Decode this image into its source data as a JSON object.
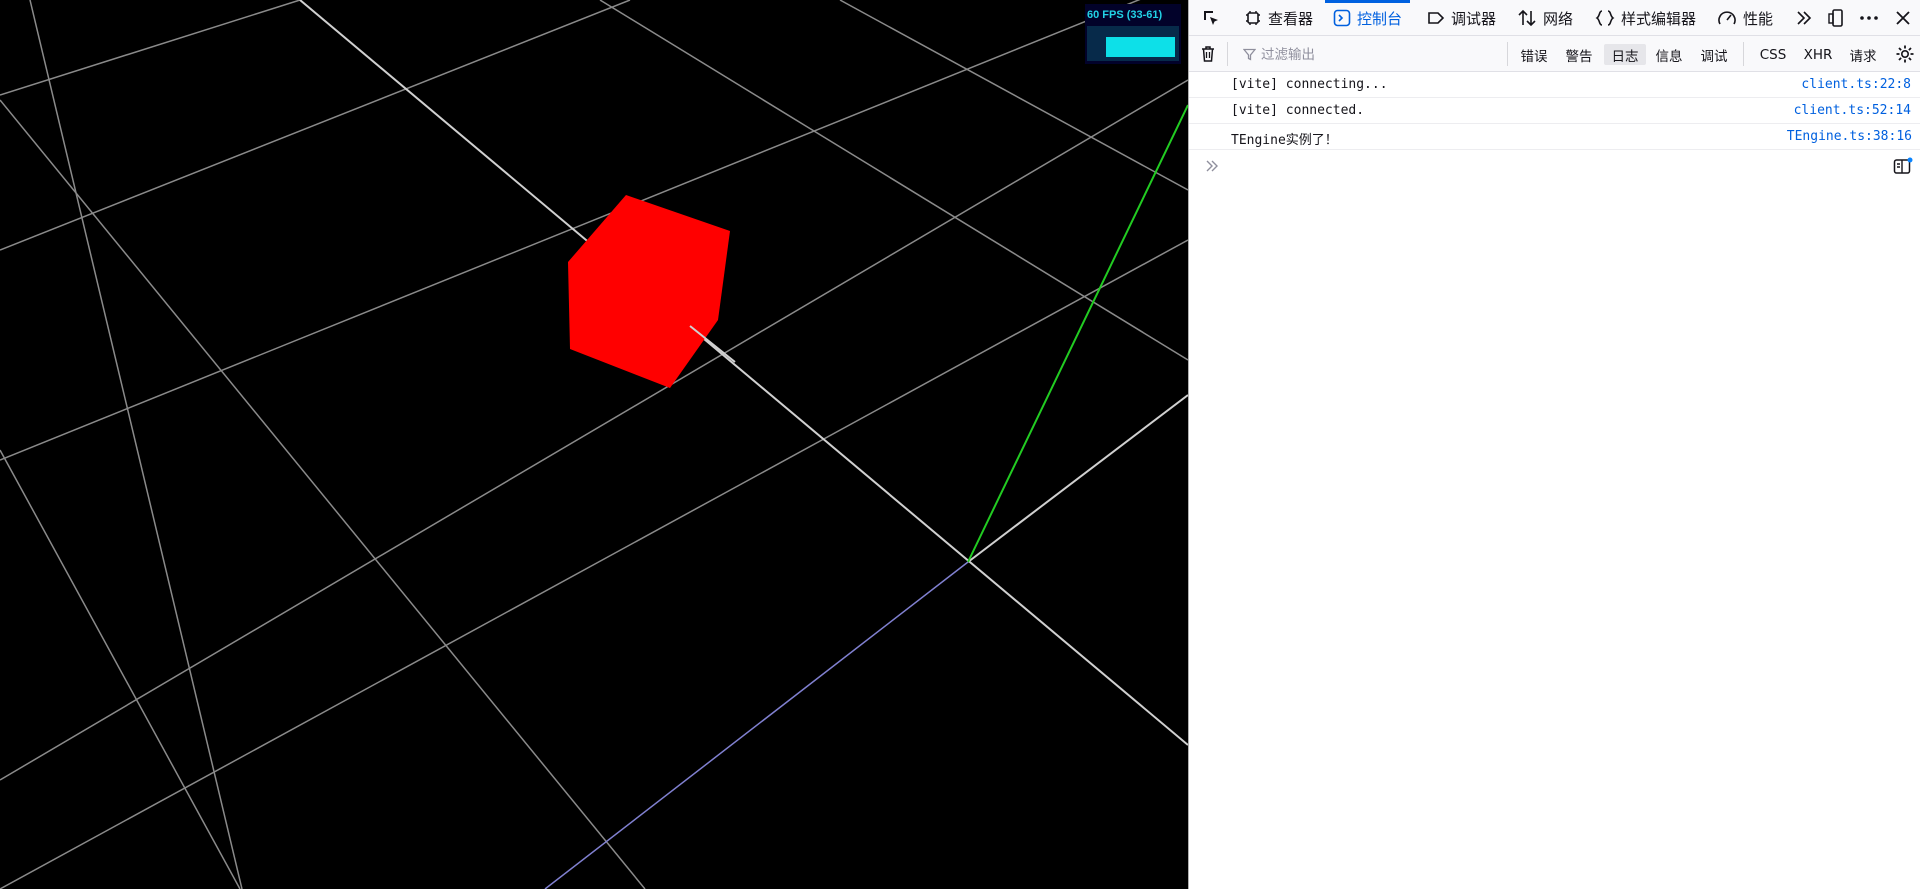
{
  "viewport": {
    "fps": {
      "text": "60 FPS (33-61)",
      "level_fraction": 0.95
    },
    "scene": {
      "colors": {
        "background": "#000000",
        "grid": "#8a8a8a",
        "axis_main": "#d0d0d0",
        "axis_y": "#22cc22",
        "axis_z": "#8080d0",
        "cube": "#ff0000"
      }
    }
  },
  "devtools": {
    "toolbar": {
      "picker_icon": "element-picker-icon",
      "tabs": [
        {
          "label": "查看器",
          "icon": "inspector-icon"
        },
        {
          "label": "控制台",
          "icon": "console-icon",
          "active": true
        },
        {
          "label": "调试器",
          "icon": "debugger-icon"
        },
        {
          "label": "网络",
          "icon": "network-icon"
        },
        {
          "label": "样式编辑器",
          "icon": "style-editor-icon"
        },
        {
          "label": "性能",
          "icon": "performance-icon"
        }
      ],
      "more_tools_icon": "chevrons-right-icon",
      "dock_icon": "responsive-design-icon",
      "menu_icon": "more-icon",
      "close_icon": "close-icon"
    },
    "filterbar": {
      "trash_icon": "trash-icon",
      "placeholder": "过滤输出",
      "levels": [
        {
          "label": "错误",
          "checked": false
        },
        {
          "label": "警告",
          "checked": false
        },
        {
          "label": "日志",
          "checked": true
        },
        {
          "label": "信息",
          "checked": false
        },
        {
          "label": "调试",
          "checked": false
        }
      ],
      "types": [
        {
          "label": "CSS"
        },
        {
          "label": "XHR"
        },
        {
          "label": "请求"
        }
      ],
      "settings_icon": "gear-icon"
    },
    "messages": [
      {
        "text": "[vite] connecting...",
        "source": "client.ts:22:8"
      },
      {
        "text": "[vite] connected.",
        "source": "client.ts:52:14"
      },
      {
        "text": "TEngine实例了！",
        "source": "TEngine.ts:38:16"
      }
    ],
    "prompt": {
      "icon": "prompt-chevron-icon",
      "split_icon": "split-editor-icon"
    }
  }
}
